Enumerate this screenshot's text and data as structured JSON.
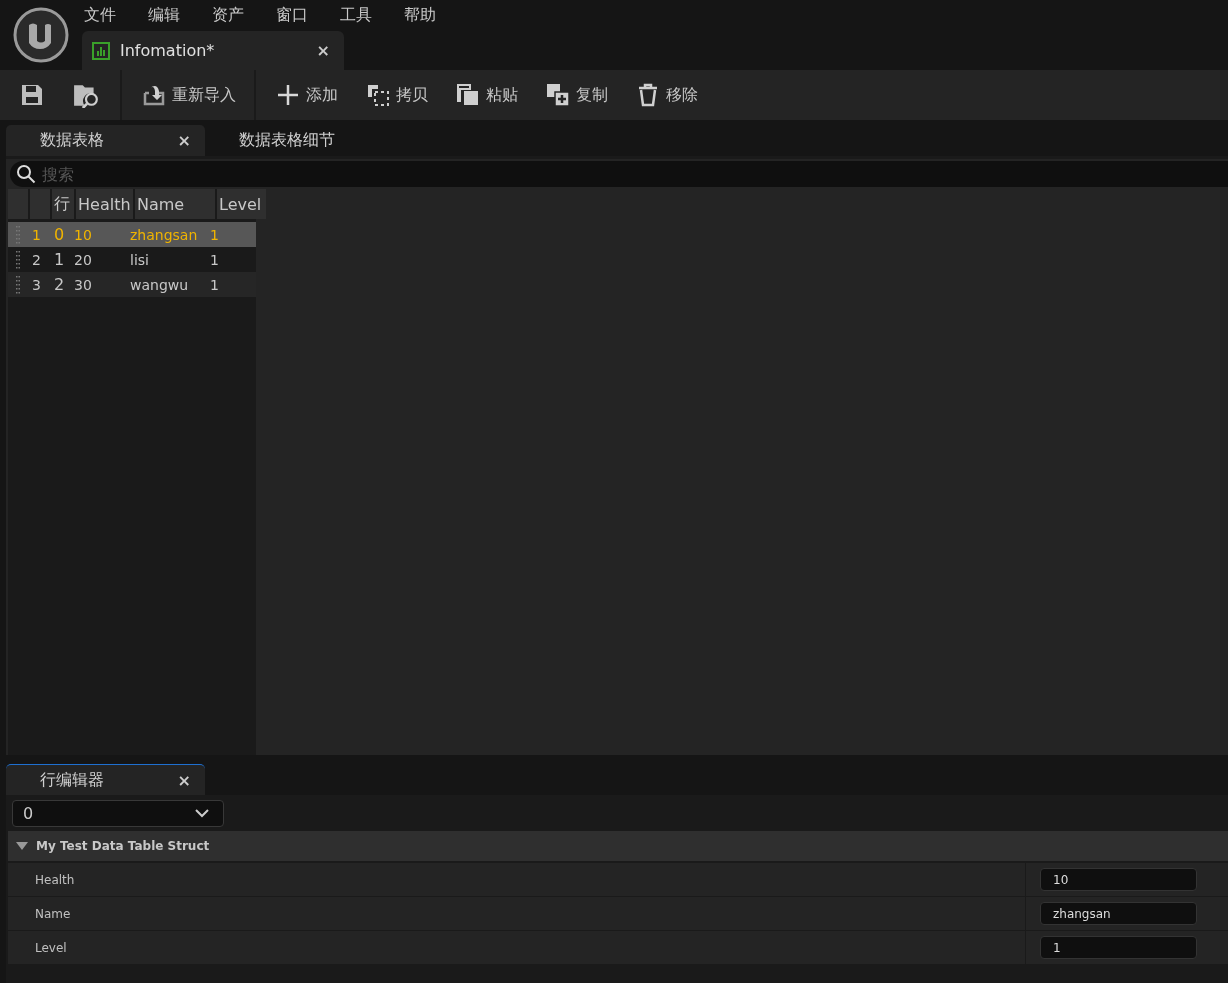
{
  "menu": [
    "文件",
    "编辑",
    "资产",
    "窗口",
    "工具",
    "帮助"
  ],
  "document_tab": {
    "label": "Infomation*",
    "close": "×",
    "selected": true
  },
  "toolbar": {
    "buttons": [
      "重新导入",
      "添加",
      "拷贝",
      "粘贴",
      "复制",
      "移除"
    ]
  },
  "panel_tabs": [
    {
      "label": "数据表格",
      "close": "×",
      "selected": true
    },
    {
      "label": "数据表格细节",
      "selected": false
    }
  ],
  "search": {
    "placeholder": "搜索"
  },
  "table": {
    "columns": [
      "行",
      "Health",
      "Name",
      "Level"
    ],
    "rows": [
      {
        "number": "1",
        "cells": [
          "0",
          "10",
          "zhangsan",
          "1"
        ],
        "selected": true
      },
      {
        "number": "2",
        "cells": [
          "1",
          "20",
          "lisi",
          "1"
        ],
        "selected": false
      },
      {
        "number": "3",
        "cells": [
          "2",
          "30",
          "wangwu",
          "1"
        ],
        "selected": false
      }
    ]
  },
  "row_editor": {
    "tab": {
      "label": "行编辑器",
      "close": "×",
      "selected": true
    },
    "row_picker": {
      "value": "0"
    },
    "category": {
      "label": "My Test Data Table Struct",
      "expanded": true
    },
    "properties": [
      {
        "name": "Health",
        "value": "10"
      },
      {
        "name": "Name",
        "value": "zhangsan"
      },
      {
        "name": "Level",
        "value": "1"
      }
    ]
  }
}
